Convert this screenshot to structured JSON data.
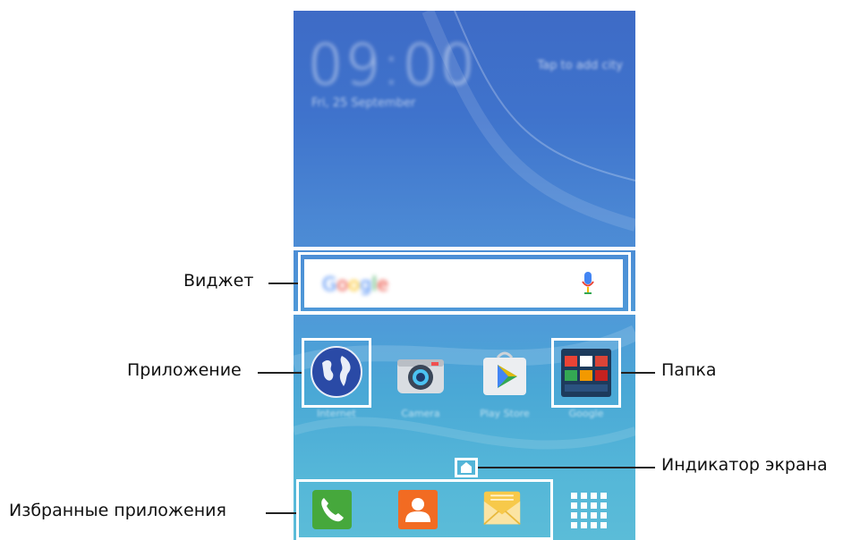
{
  "lockscreen": {
    "clock": "09:00",
    "date": "Fri, 25 September",
    "weather_hint": "Tap to add city"
  },
  "search_widget": {
    "logo_letters": [
      "G",
      "o",
      "o",
      "g",
      "l",
      "e"
    ],
    "mic_icon": "microphone-icon"
  },
  "apps": [
    {
      "label": "Internet",
      "icon": "globe-icon"
    },
    {
      "label": "Camera",
      "icon": "camera-icon"
    },
    {
      "label": "Play Store",
      "icon": "play-store-icon"
    },
    {
      "label": "Google",
      "icon": "folder-icon"
    }
  ],
  "dock": [
    {
      "icon": "phone-icon"
    },
    {
      "icon": "contacts-icon"
    },
    {
      "icon": "messages-icon"
    },
    {
      "icon": "apps-grid-icon"
    }
  ],
  "callouts": {
    "widget": "Виджет",
    "app": "Приложение",
    "folder": "Папка",
    "screen_indicator": "Индикатор экрана",
    "favorites": "Избранные приложения"
  },
  "colors": {
    "frame": "#ffffff",
    "wallpaper": "#4a86d2",
    "phone_green": "#46a83c",
    "contacts_orange": "#f26b22",
    "message_yellow": "#f7c94a"
  }
}
